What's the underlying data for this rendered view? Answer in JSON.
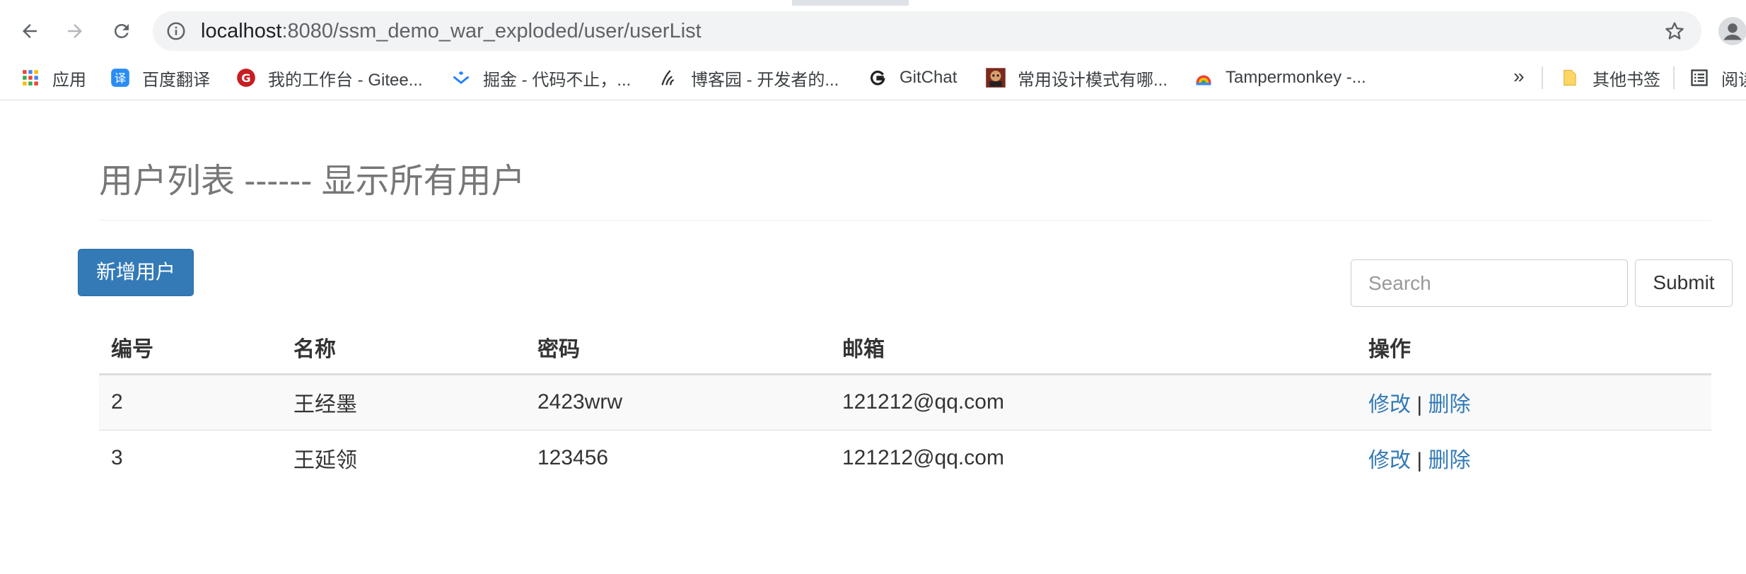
{
  "browser": {
    "url_host": "localhost",
    "url_rest": ":8080/ssm_demo_war_exploded/user/userList",
    "icons": {
      "back": "back-arrow-icon",
      "forward": "forward-arrow-icon",
      "reload": "reload-icon",
      "info": "info-icon",
      "star": "star-icon",
      "profile": "profile-icon"
    },
    "bookmarks": [
      {
        "label": "应用",
        "icon": "apps-grid-icon"
      },
      {
        "label": "百度翻译",
        "icon": "baidu-translate-icon"
      },
      {
        "label": "我的工作台 - Gitee...",
        "icon": "gitee-icon"
      },
      {
        "label": "掘金 - 代码不止，...",
        "icon": "juejin-icon"
      },
      {
        "label": "博客园 - 开发者的...",
        "icon": "cnblogs-icon"
      },
      {
        "label": "GitChat",
        "icon": "gitchat-icon"
      },
      {
        "label": "常用设计模式有哪...",
        "icon": "site-avatar-icon"
      },
      {
        "label": "Tampermonkey -...",
        "icon": "tampermonkey-icon"
      }
    ],
    "more": "»",
    "other_bookmarks": "其他书签",
    "reading_list": "阅读"
  },
  "page": {
    "title": "用户列表 ------ 显示所有用户",
    "add_button": "新增用户",
    "search_placeholder": "Search",
    "submit_button": "Submit"
  },
  "table": {
    "headers": [
      "编号",
      "名称",
      "密码",
      "邮箱",
      "操作"
    ],
    "rows": [
      {
        "id": "2",
        "name": "王经墨",
        "password": "2423wrw",
        "email": "121212@qq.com"
      },
      {
        "id": "3",
        "name": "王延领",
        "password": "123456",
        "email": "121212@qq.com"
      }
    ],
    "edit_label": "修改",
    "separator": "|",
    "delete_label": "删除"
  },
  "colors": {
    "primary": "#337ab7",
    "title_gray": "#777777"
  }
}
